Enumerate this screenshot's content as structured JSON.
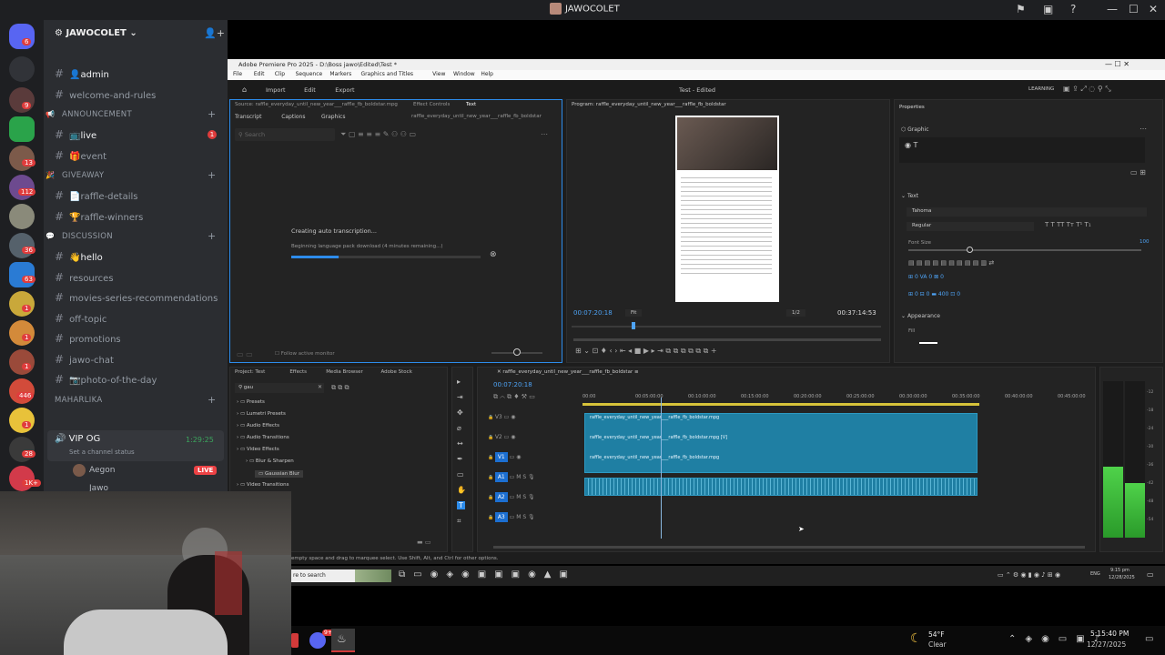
{
  "discord": {
    "window_title": "JAWOCOLET",
    "guild_name": "JAWOCOLET",
    "server_badges": [
      "6",
      "9",
      "13",
      "112",
      "36",
      "63",
      "1",
      "1",
      "1",
      "446",
      "1",
      "28",
      "1K+"
    ],
    "channels": [
      {
        "type": "channel",
        "name": "admin",
        "emoji": "👤",
        "active": true
      },
      {
        "type": "channel",
        "name": "welcome-and-rules",
        "emoji": "",
        "icon": "rules"
      },
      {
        "type": "category",
        "name": "ANNOUNCEMENT",
        "emoji": "📢"
      },
      {
        "type": "channel",
        "name": "live",
        "emoji": "📺",
        "active": true,
        "unread": "1"
      },
      {
        "type": "channel",
        "name": "event",
        "emoji": "🎁"
      },
      {
        "type": "category",
        "name": "GIVEAWAY",
        "emoji": "🎉"
      },
      {
        "type": "channel",
        "name": "raffle-details",
        "emoji": "📄"
      },
      {
        "type": "channel",
        "name": "raffle-winners",
        "emoji": "🏆"
      },
      {
        "type": "category",
        "name": "DISCUSSION",
        "emoji": "💬"
      },
      {
        "type": "channel",
        "name": "hello",
        "emoji": "👋",
        "active": true
      },
      {
        "type": "channel",
        "name": "resources",
        "emoji": ""
      },
      {
        "type": "channel",
        "name": "movies-series-recommendations",
        "emoji": ""
      },
      {
        "type": "channel",
        "name": "off-topic",
        "emoji": ""
      },
      {
        "type": "channel",
        "name": "promotions",
        "emoji": ""
      },
      {
        "type": "channel",
        "name": "jawo-chat",
        "emoji": ""
      },
      {
        "type": "channel",
        "name": "photo-of-the-day",
        "emoji": "📷"
      },
      {
        "type": "category",
        "name": "MAHARLIKA",
        "emoji": ""
      }
    ],
    "voice": {
      "name": "VIP OG",
      "status": "Set a channel status",
      "timer": "1:29:25",
      "members": [
        {
          "name": "Aegon",
          "badge": "LIVE"
        },
        {
          "name": "Jawo",
          "badge": ""
        }
      ]
    }
  },
  "premiere": {
    "title": "Adobe Premiere Pro 2025 - D:\\Boss jawo\\Edited\\Test *",
    "menu": [
      "File",
      "Edit",
      "Clip",
      "Sequence",
      "Markers",
      "Graphics and Titles",
      "View",
      "Window",
      "Help"
    ],
    "workspace_tabs": [
      "Import",
      "Edit",
      "Export"
    ],
    "project_center": "Test - Edited",
    "learning": "LEARNING",
    "source_tab": "Source: raffle_everyday_until_new_year___raffle_fb_boldstar.mpg",
    "effect_controls": "Effect Controls",
    "text_tab": "Text",
    "subtabs": [
      "Transcript",
      "Captions",
      "Graphics"
    ],
    "clip_name": "raffle_everyday_until_new_year___raffle_fb_boldstar",
    "search_placeholder": "Search",
    "transcribe_title": "Creating auto transcription...",
    "transcribe_status": "Beginning language pack download (4 minutes remaining...)",
    "transcribe_progress": 0.25,
    "follow_monitor": "Follow active monitor",
    "program_tab": "Program: raffle_everyday_until_new_year___raffle_fb_boldstar",
    "program_timecode": "00:07:20:18",
    "program_fit": "Fit",
    "program_res": "1/2",
    "program_duration": "00:37:14:53",
    "properties": {
      "title": "Properties",
      "graphic": "Graphic",
      "text_section": "Text",
      "font": "Tahoma",
      "style": "Regular",
      "font_size_label": "Font Size",
      "font_size": "100",
      "appearance": "Appearance",
      "fill": "Fill",
      "values": [
        "0",
        "0",
        "0",
        "0",
        "0",
        "400",
        "0"
      ]
    },
    "project_tabs": [
      "Project: Test",
      "Effects",
      "Media Browser",
      "Adobe Stock"
    ],
    "effects_search": "gau",
    "effects_tree": [
      "Presets",
      "Lumetri Presets",
      "Audio Effects",
      "Audio Transitions",
      "Video Effects",
      "Blur & Sharpen",
      "Gaussian Blur",
      "Video Transitions"
    ],
    "timeline_tab": "raffle_everyday_until_new_year___raffle_fb_boldstar",
    "timeline_timecode": "00:07:20:18",
    "ruler": [
      "00:00",
      "00:05:00:00",
      "00:10:00:00",
      "00:15:00:00",
      "00:20:00:00",
      "00:25:00:00",
      "00:30:00:00",
      "00:35:00:00",
      "00:40:00:00",
      "00:45:00:00"
    ],
    "tracks": [
      "V3",
      "V2",
      "V1",
      "A1",
      "A2",
      "A3"
    ],
    "clips": [
      "raffle_everyday_until_new_year___raffle_fb_boldstar.mpg",
      "raffle_everyday_until_new_year___raffle_fb_boldstar.mpg [V]",
      "raffle_everyday_until_new_year___raffle_fb_boldstar.mpg"
    ],
    "meter_labels": [
      "-12",
      "-18",
      "-24",
      "-30",
      "-36",
      "-42",
      "-48",
      "-54"
    ],
    "status_bar": "empty space and drag to marquee select. Use Shift, Alt, and Ctrl for other options."
  },
  "inner_taskbar": {
    "search": "re to search",
    "time": "9:15 pm",
    "date": "12/28/2025",
    "lang": "ENG"
  },
  "outer_taskbar": {
    "weather_temp": "54°F",
    "weather_desc": "Clear",
    "time": "5:15:40 PM",
    "date": "12/27/2025",
    "badge": "9+"
  },
  "colors": {
    "discord_bg": "#2b2d31",
    "rail": "#1e1f22",
    "clip": "#1f7fa3",
    "premiere_bg": "#1d1d1d",
    "live": "#ed4245",
    "accent": "#2d8ceb"
  }
}
